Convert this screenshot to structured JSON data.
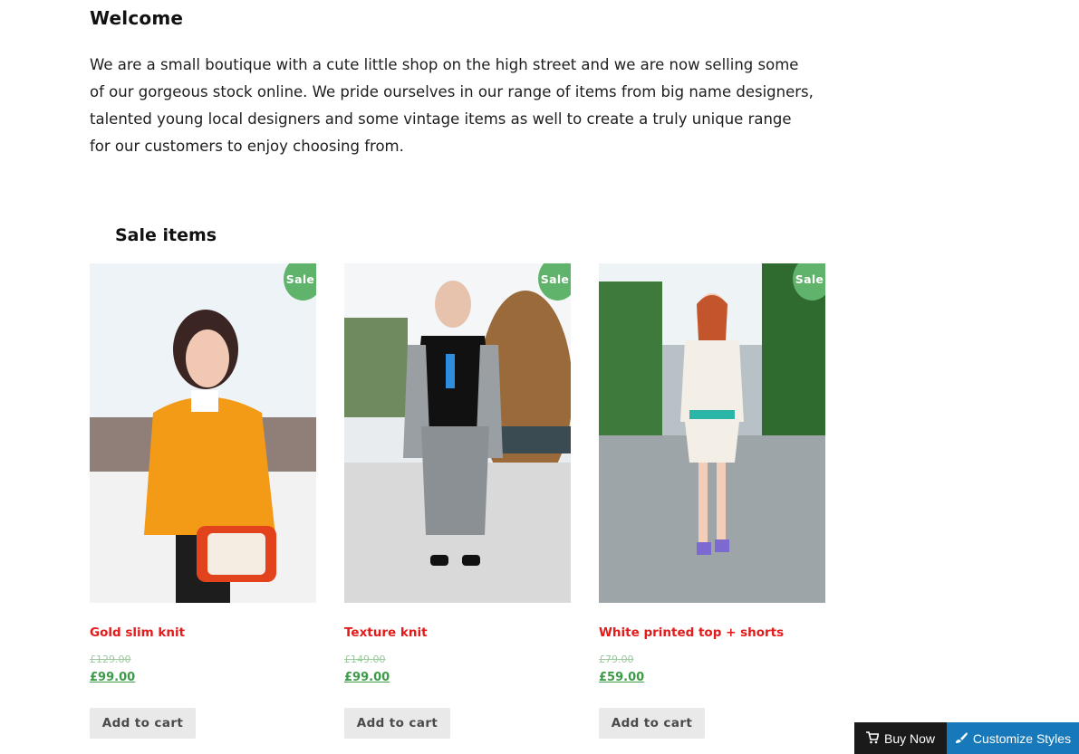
{
  "welcome": {
    "title": "Welcome",
    "intro": "We are a small boutique with a cute little shop on the high street and we are now selling some of our gorgeous stock online. We pride ourselves in our range of items from big name designers, talented young local designers and some vintage items as well to create a truly unique range for our customers to enjoy choosing from."
  },
  "sale": {
    "heading": "Sale items",
    "badge": "Sale!",
    "add_to_cart": "Add to cart",
    "products": [
      {
        "name": "Gold slim knit",
        "old_price": "£129.00",
        "price": "£99.00"
      },
      {
        "name": "Texture knit",
        "old_price": "£149.00",
        "price": "£99.00"
      },
      {
        "name": "White printed top + shorts",
        "old_price": "£79.00",
        "price": "£59.00"
      }
    ]
  },
  "bottom_bar": {
    "buy_now": "Buy Now",
    "customize": "Customize Styles",
    "buy_icon": "cart-icon",
    "customize_icon": "brush-icon"
  },
  "colors": {
    "badge": "#5fb36a",
    "product_name": "#e21b1b",
    "price": "#3c9a48",
    "buy_now_bg": "#1a1a1a",
    "customize_bg": "#1779b9"
  }
}
